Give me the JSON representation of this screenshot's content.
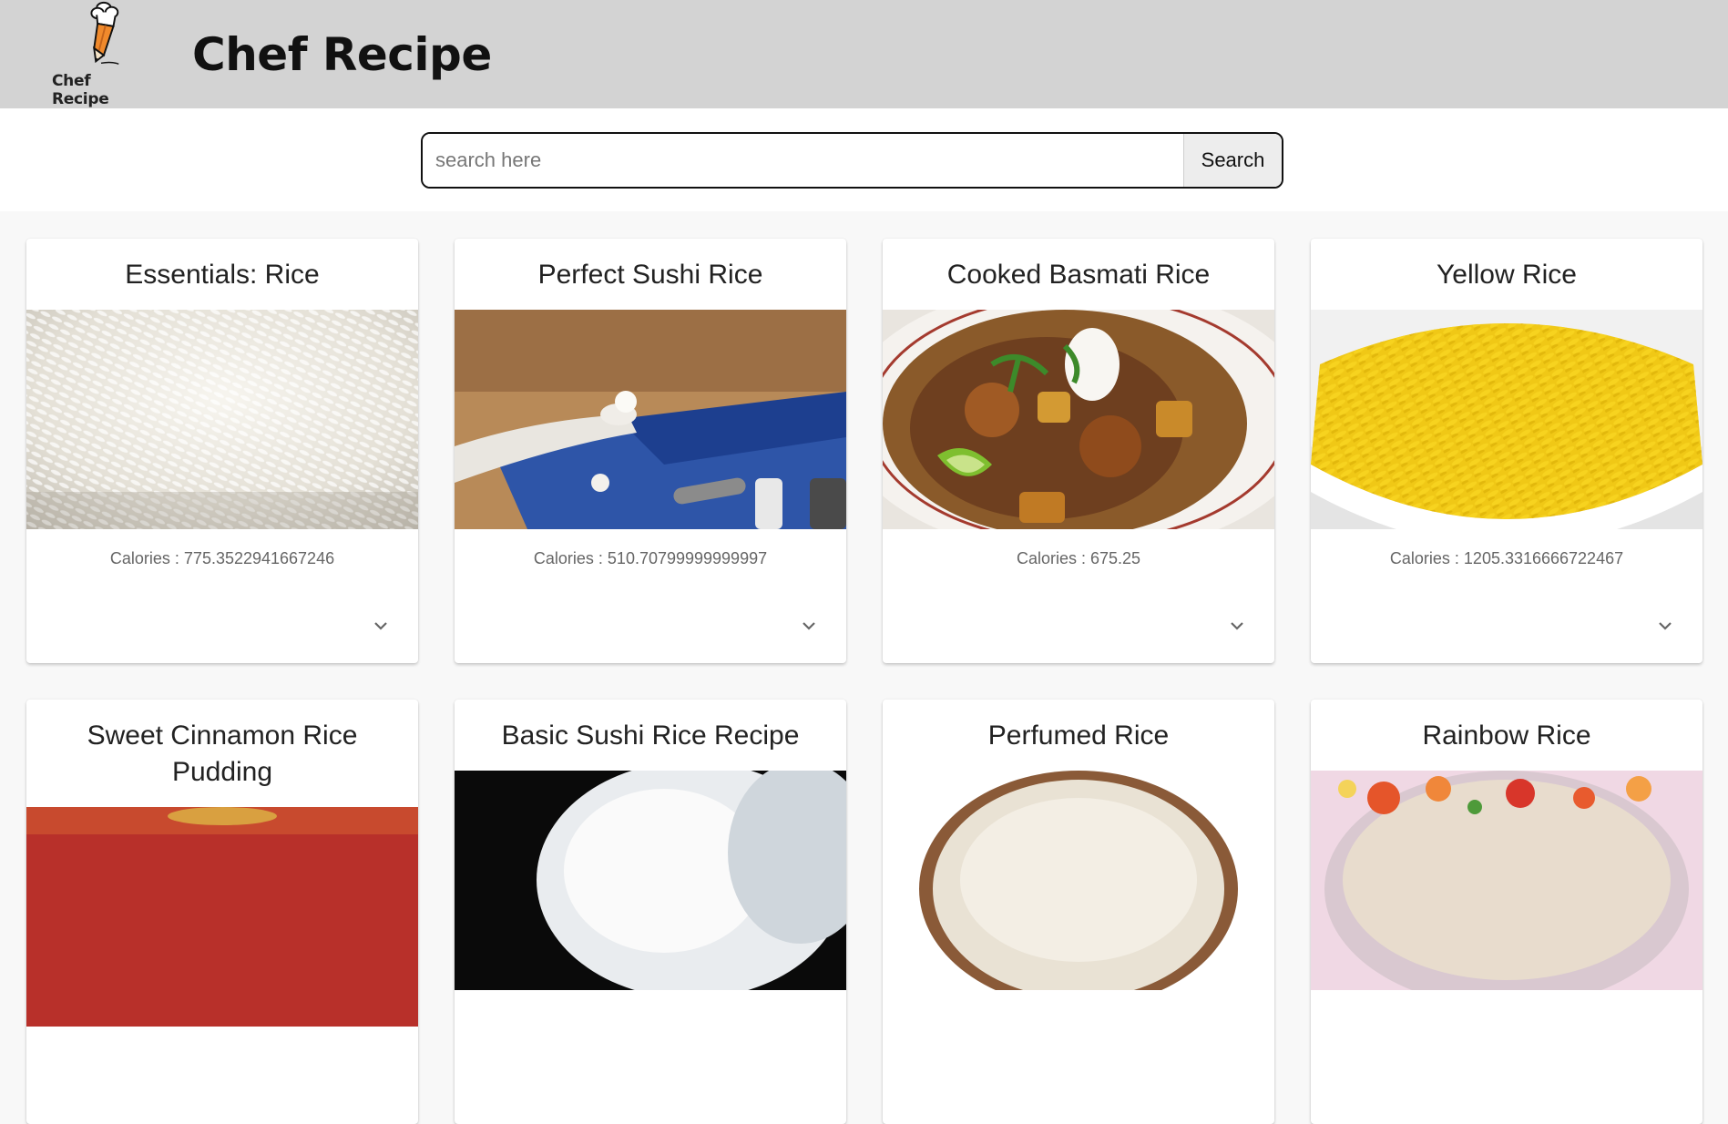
{
  "header": {
    "logo_text": "Chef Recipe",
    "title": "Chef Recipe"
  },
  "search": {
    "placeholder": "search here",
    "value": "",
    "button_label": "Search"
  },
  "cards": [
    {
      "title": "Essentials: Rice",
      "calories_text": "Calories : 775.3522941667246",
      "image": "white-rice-photo"
    },
    {
      "title": "Perfect Sushi Rice",
      "calories_text": "Calories : 510.70799999999997",
      "image": "sushi-chef-hand-photo"
    },
    {
      "title": "Cooked Basmati Rice",
      "calories_text": "Calories : 675.25",
      "image": "curry-plate-photo"
    },
    {
      "title": "Yellow Rice",
      "calories_text": "Calories : 1205.3316666722467",
      "image": "yellow-rice-bowl-photo"
    },
    {
      "title": "Sweet Cinnamon Rice Pudding",
      "image": "rice-pudding-photo"
    },
    {
      "title": "Basic Sushi Rice Recipe",
      "image": "sushi-rice-bowl-photo"
    },
    {
      "title": "Perfumed Rice",
      "image": "perfumed-rice-bowl-photo"
    },
    {
      "title": "Rainbow Rice",
      "image": "rainbow-rice-salad-photo"
    }
  ],
  "colors": {
    "header_bg": "#d3d3d3",
    "page_bg": "#f8f8f8",
    "card_bg": "#ffffff",
    "calories_text": "#666666"
  },
  "icons": [
    "chef-pencil-logo-icon",
    "chevron-down-icon"
  ]
}
